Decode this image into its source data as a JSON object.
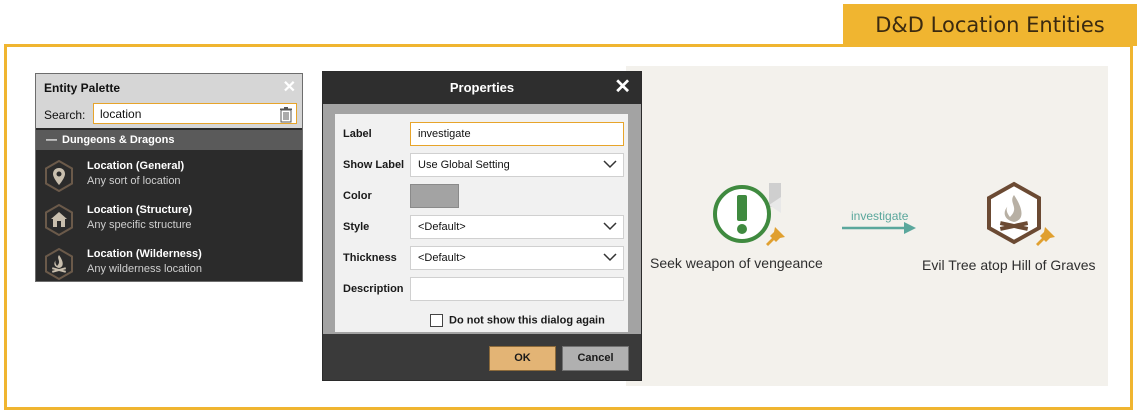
{
  "banner": {
    "title": "D&D Location Entities"
  },
  "palette": {
    "title": "Entity Palette",
    "search_label": "Search:",
    "search_value": "location",
    "group": "Dungeons & Dragons",
    "items": [
      {
        "title": "Location (General)",
        "subtitle": "Any sort of location",
        "icon": "map-pin-icon"
      },
      {
        "title": "Location (Structure)",
        "subtitle": "Any specific structure",
        "icon": "house-icon"
      },
      {
        "title": "Location (Wilderness)",
        "subtitle": "Any wilderness location",
        "icon": "campfire-icon"
      }
    ]
  },
  "dialog": {
    "title": "Properties",
    "fields": {
      "label": {
        "label": "Label",
        "value": "investigate"
      },
      "show_label": {
        "label": "Show Label",
        "value": "Use Global Setting"
      },
      "color": {
        "label": "Color",
        "value": "#a3a3a3"
      },
      "style": {
        "label": "Style",
        "value": "<Default>"
      },
      "thickness": {
        "label": "Thickness",
        "value": "<Default>"
      },
      "description": {
        "label": "Description",
        "value": ""
      }
    },
    "checkbox_label": "Do not show this dialog again",
    "ok_label": "OK",
    "cancel_label": "Cancel"
  },
  "canvas": {
    "source_node": {
      "label": "Seek weapon of vengeance",
      "icon": "exclamation-icon",
      "color": "#3f8a3f"
    },
    "target_node": {
      "label": "Evil Tree atop Hill of Graves",
      "icon": "campfire-icon",
      "color": "#6b4a33"
    },
    "link_label": "investigate",
    "link_color": "#5aa79c"
  },
  "colors": {
    "accent": "#f0b530",
    "pin": "#e0a030"
  }
}
